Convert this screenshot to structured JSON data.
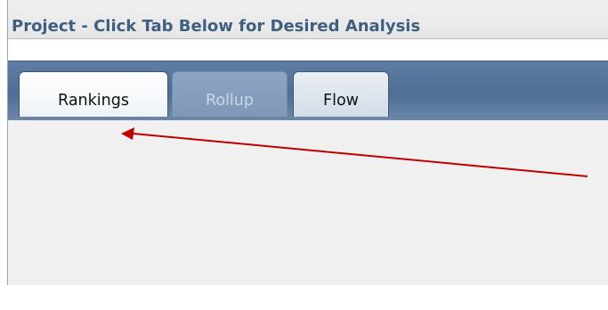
{
  "header": {
    "title": "Project - Click Tab Below for Desired Analysis"
  },
  "tabs": [
    {
      "label": "Rankings",
      "state": "active"
    },
    {
      "label": "Rollup",
      "state": "disabled"
    },
    {
      "label": "Flow",
      "state": "normal"
    }
  ],
  "annotation": {
    "arrow_color": "#c00000",
    "meaning": "points-to-rankings-tab"
  },
  "colors": {
    "title_text": "#3f5f80",
    "tab_strip": "#4f6e94",
    "content_bg": "#f0f0f0"
  }
}
